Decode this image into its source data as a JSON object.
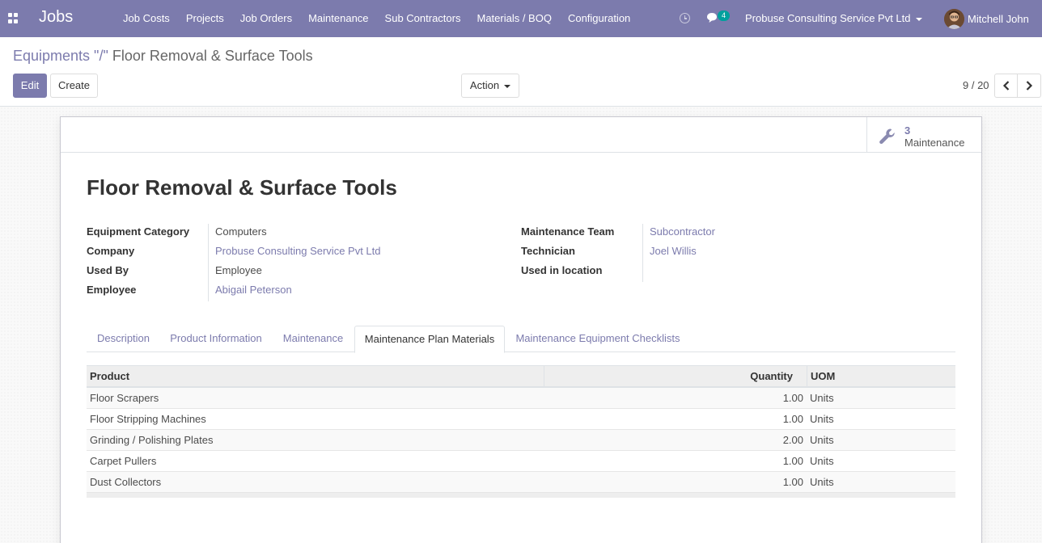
{
  "navbar": {
    "brand": "Jobs",
    "menu": [
      "Job Costs",
      "Projects",
      "Job Orders",
      "Maintenance",
      "Sub Contractors",
      "Materials / BOQ",
      "Configuration"
    ],
    "chat_count": "4",
    "company": "Probuse Consulting Service Pvt Ltd",
    "user": "Mitchell John",
    "accent": "#7c7bad"
  },
  "control_panel": {
    "breadcrumb_parent": "Equipments \"/\"",
    "breadcrumb_current": "Floor Removal & Surface Tools",
    "edit_label": "Edit",
    "create_label": "Create",
    "action_label": "Action",
    "pager": "9 / 20"
  },
  "form": {
    "smart_button": {
      "count": "3",
      "label": "Maintenance",
      "icon": "wrench-icon"
    },
    "title": "Floor Removal & Surface Tools",
    "left_fields": [
      {
        "label": "Equipment Category",
        "value": "Computers"
      },
      {
        "label": "Company",
        "value": "Probuse Consulting Service Pvt Ltd"
      },
      {
        "label": "Used By",
        "value": "Employee"
      },
      {
        "label": "Employee",
        "value": "Abigail Peterson"
      }
    ],
    "right_fields": [
      {
        "label": "Maintenance Team",
        "value": "Subcontractor"
      },
      {
        "label": "Technician",
        "value": "Joel Willis"
      },
      {
        "label": "Used in location",
        "value": ""
      }
    ],
    "tabs": [
      "Description",
      "Product Information",
      "Maintenance",
      "Maintenance Plan Materials",
      "Maintenance Equipment Checklists"
    ],
    "active_tab": "Maintenance Plan Materials"
  },
  "materials_table": {
    "columns": [
      "Product",
      "Quantity",
      "UOM"
    ],
    "rows": [
      {
        "product": "Floor Scrapers",
        "quantity": "1.00",
        "uom": "Units"
      },
      {
        "product": "Floor Stripping Machines",
        "quantity": "1.00",
        "uom": "Units"
      },
      {
        "product": "Grinding / Polishing Plates",
        "quantity": "2.00",
        "uom": "Units"
      },
      {
        "product": "Carpet Pullers",
        "quantity": "1.00",
        "uom": "Units"
      },
      {
        "product": "Dust Collectors",
        "quantity": "1.00",
        "uom": "Units"
      }
    ]
  }
}
